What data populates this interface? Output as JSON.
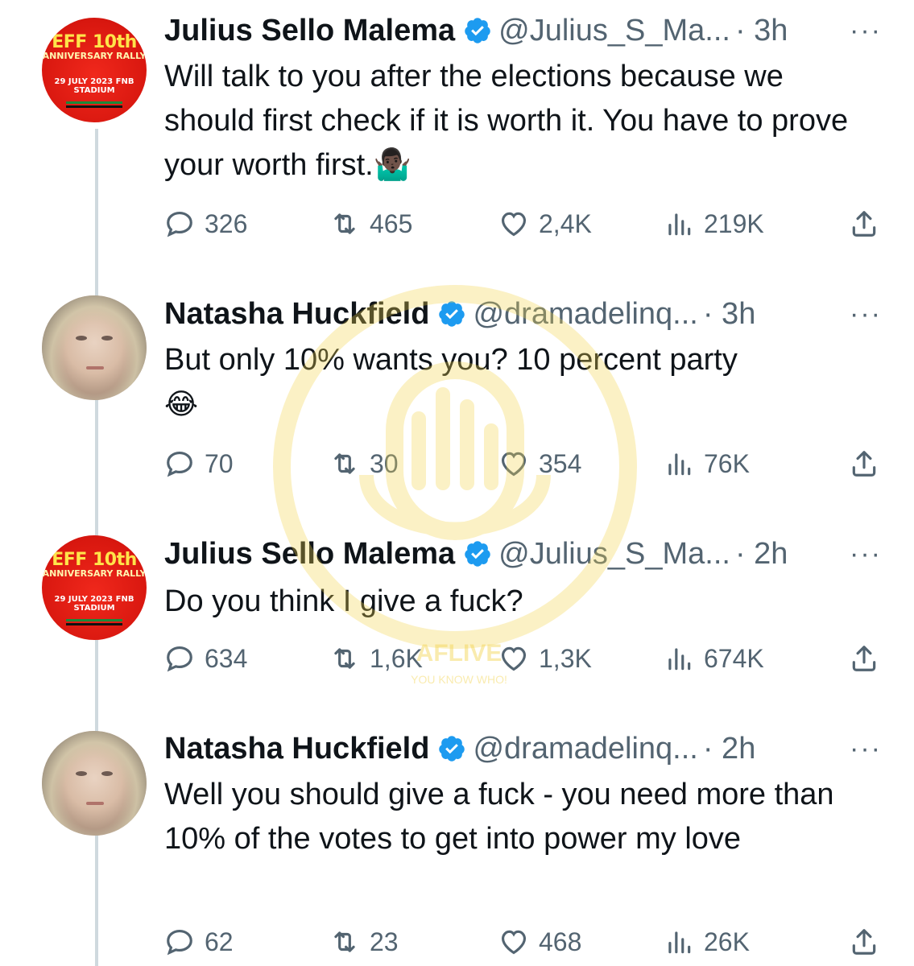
{
  "tweets": [
    {
      "avatar": {
        "line1": "EFF 10th",
        "line2": "ANNIVERSARY RALLY",
        "line3": "29 JULY 2023 FNB STADIUM"
      },
      "name": "Julius Sello Malema",
      "handle": "@Julius_S_Ma...",
      "time": "· 3h",
      "text": "Will talk to you after the elections because we should first check if it is worth it. You have to prove your worth first.🤷🏿‍♂️",
      "replies": "326",
      "retweets": "465",
      "likes": "2,4K",
      "views": "219K"
    },
    {
      "name": "Natasha Huckfield",
      "handle": "@dramadelinq...",
      "time": "· 3h",
      "text": "But only 10% wants you? 10 percent party",
      "emoji": "😂",
      "replies": "70",
      "retweets": "30",
      "likes": "354",
      "views": "76K"
    },
    {
      "avatar": {
        "line1": "EFF 10th",
        "line2": "ANNIVERSARY RALLY",
        "line3": "29 JULY 2023 FNB STADIUM"
      },
      "name": "Julius Sello Malema",
      "handle": "@Julius_S_Ma...",
      "time": "· 2h",
      "text": "Do you think I give a fuck?",
      "replies": "634",
      "retweets": "1,6K",
      "likes": "1,3K",
      "views": "674K"
    },
    {
      "name": "Natasha Huckfield",
      "handle": "@dramadelinq...",
      "time": "· 2h",
      "text": "Well you should give a fuck - you need more than 10% of the votes to get into power my love",
      "replies": "62",
      "retweets": "23",
      "likes": "468",
      "views": "26K"
    }
  ],
  "more_glyph": "···",
  "watermark": {
    "text": "AFLIVE",
    "subtext": "YOU KNOW WHO!"
  },
  "colors": {
    "verified": "#1d9bf0",
    "muted": "#536471",
    "text": "#0f1419",
    "thread_line": "#cfd9de",
    "eff_red": "#d8170f",
    "eff_yellow": "#ffe44a",
    "watermark": "#f3d44e"
  },
  "icons": [
    "reply-icon",
    "retweet-icon",
    "like-icon",
    "views-icon",
    "share-icon",
    "verified-badge-icon",
    "more-icon"
  ]
}
